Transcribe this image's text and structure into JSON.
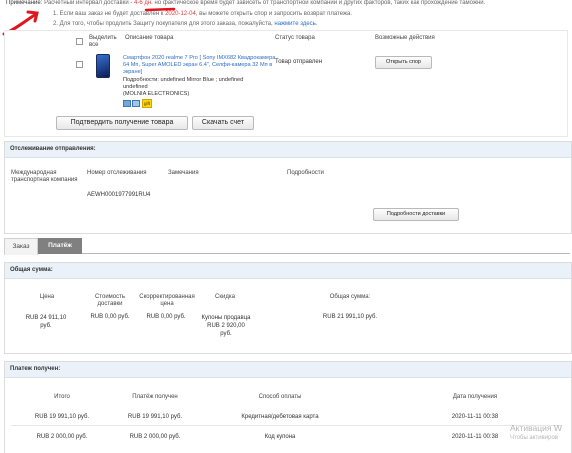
{
  "note": {
    "prefix": "Примечание:",
    "text_a": "Расчётный интервал доставки - ",
    "interval": "4-6 дн.",
    "text_b": " но фактическое время будет зависеть от транспортной компании и других факторов, таких как прохождение таможни.",
    "line1_a": "1. Если ваш заказ не будет доставлен к ",
    "line1_date": "2020-12-04",
    "line1_b": ", вы можете открыть спор и запросить возврат платежа.",
    "line2_a": "2. Для того, чтобы продлить Защиту покупателя для этого заказа, пожалуйста, ",
    "line2_link": "нажмите здесь",
    "line2_b": "."
  },
  "order_table": {
    "col_select": "Выделить все",
    "col_desc": "Описание товара",
    "col_status": "Статус товара",
    "col_actions": "Возможные действия",
    "item": {
      "title": "Смартфон 2020 realme 7 Pro [ Sony IMX682 Квадрокамера 64 Мп, Super AMOLED экран 6.4\", Селфи-камера 32 Мп в экране]",
      "details_1": "Подробности: undefined Mirror Blue ; undefined",
      "details_2": "undefined",
      "seller": "(MOLNIA ELECTRONICS)",
      "badge": "gift",
      "status": "Товар отправлен",
      "dispute_label": "Открыть спор"
    },
    "confirm_label": "Подтвердить получение товара",
    "invoice_label": "Скачать счет"
  },
  "tracking": {
    "title": "Отслеживание отправления:",
    "col_company": "Международная транспортная компания",
    "col_number": "Номер отслеживания",
    "col_notes": "Замечания",
    "col_details": "Подробности",
    "number": "AEWH0001977991RU4",
    "details_label": "Подробности доставки"
  },
  "tabs": {
    "order": "Заказ",
    "payment": "Платёж",
    "active": "payment"
  },
  "total": {
    "title": "Общая сумма:",
    "headers": [
      "Цена",
      "Стоимость доставки",
      "Скорректированная цена",
      "Скидка",
      "Общая сумма:"
    ],
    "price": "RUB 24 911,10 руб.",
    "shipping": "RUB 0,00 руб.",
    "adjusted": "RUB 0,00 руб.",
    "discount": "Купоны продавца RUB 2 920,00 руб.",
    "sum": "RUB 21 991,10 руб."
  },
  "received": {
    "title": "Платеж получен:",
    "headers": [
      "Итого",
      "Платёж получен",
      "Способ оплаты",
      "Дата получения"
    ],
    "rows": [
      {
        "total": "RUB 19 991,10 руб.",
        "received": "RUB 19 991,10 руб.",
        "method": "Кредитная/дебетовая карта",
        "date": "2020-11-11 00:38"
      },
      {
        "total": "RUB 2 000,00 руб.",
        "received": "RUB 2 000,00 руб.",
        "method": "Код купона",
        "date": "2020-11-11 00:38"
      }
    ]
  },
  "watermark": {
    "line1": "Активация W",
    "line2": "Чтобы активиров"
  },
  "colors": {
    "accent_red": "#e4393c",
    "link_blue": "#2d6dcc",
    "section_header": "#eaf1f8"
  }
}
